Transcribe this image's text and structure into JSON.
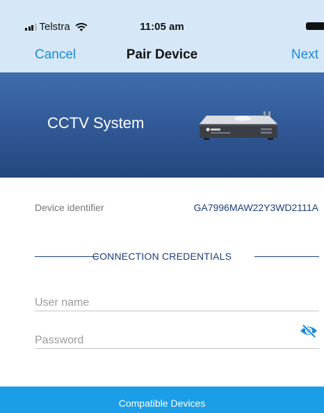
{
  "status_bar": {
    "carrier": "Telstra",
    "time": "11:05 am",
    "icons": [
      "signal-icon",
      "wifi-icon",
      "battery-icon"
    ]
  },
  "navbar": {
    "cancel_label": "Cancel",
    "title": "Pair Device",
    "next_label": "Next"
  },
  "hero": {
    "title": "CCTV System",
    "device_icon": "dvr-recorder-icon"
  },
  "device": {
    "identifier_label": "Device identifier",
    "identifier_value": "GA7996MAW22Y3WD2111A"
  },
  "credentials": {
    "section_title": "CONNECTION CREDENTIALS",
    "username_placeholder": "User name",
    "username_value": "",
    "password_placeholder": "Password",
    "password_value": "",
    "visibility_icon": "eye-slash-icon"
  },
  "footer": {
    "button_label": "Compatible Devices"
  },
  "colors": {
    "header_bg": "#d6e8f8",
    "accent": "#1d8ad6",
    "hero_top": "#3f6dae",
    "hero_bottom": "#24467f",
    "navy_text": "#1b3f78",
    "button_bg": "#1c9ee6"
  }
}
